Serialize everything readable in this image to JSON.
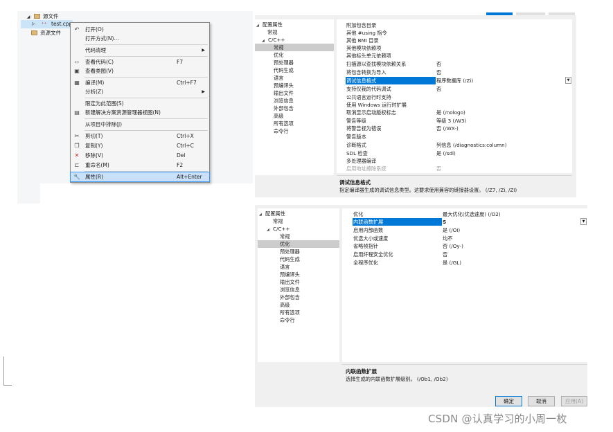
{
  "solution_explorer": {
    "source_folder": "源文件",
    "file_name": "test.cpp",
    "resource_folder": "资源文件"
  },
  "context_menu": {
    "items": [
      {
        "label": "打开(O)",
        "shortcut": "",
        "icon": "open-icon"
      },
      {
        "label": "打开方式(N)...",
        "shortcut": "",
        "icon": ""
      },
      {
        "label": "代码清理",
        "shortcut": "",
        "icon": ""
      },
      {
        "label": "查看代码(C)",
        "shortcut": "F7",
        "icon": "code-icon"
      },
      {
        "label": "查看类图(V)",
        "shortcut": "",
        "icon": "class-diagram-icon"
      },
      {
        "label": "编译(M)",
        "shortcut": "Ctrl+F7",
        "icon": "compile-icon"
      },
      {
        "label": "分析(Z)",
        "shortcut": "",
        "icon": ""
      },
      {
        "label": "限定为此范围(S)",
        "shortcut": "",
        "icon": ""
      },
      {
        "label": "新建解决方案资源管理器视图(N)",
        "shortcut": "",
        "icon": "new-view-icon"
      },
      {
        "label": "从项目中排除(J)",
        "shortcut": "",
        "icon": ""
      },
      {
        "label": "剪切(T)",
        "shortcut": "Ctrl+X",
        "icon": "cut-icon"
      },
      {
        "label": "复制(Y)",
        "shortcut": "Ctrl+C",
        "icon": "copy-icon"
      },
      {
        "label": "移除(V)",
        "shortcut": "Del",
        "icon": "remove-icon"
      },
      {
        "label": "重命名(M)",
        "shortcut": "F2",
        "icon": "rename-icon"
      },
      {
        "label": "属性(R)",
        "shortcut": "Alt+Enter",
        "icon": "wrench-icon"
      }
    ]
  },
  "dialog1": {
    "tree": [
      {
        "label": "配置属性",
        "expanded": true
      },
      {
        "label": "常规"
      },
      {
        "label": "C/C++",
        "expanded": true
      },
      {
        "label": "常规",
        "selected": true
      },
      {
        "label": "优化"
      },
      {
        "label": "预处理器"
      },
      {
        "label": "代码生成"
      },
      {
        "label": "语言"
      },
      {
        "label": "预编译头"
      },
      {
        "label": "输出文件"
      },
      {
        "label": "浏览信息"
      },
      {
        "label": "外部包含"
      },
      {
        "label": "高级"
      },
      {
        "label": "所有选项"
      },
      {
        "label": "命令行"
      }
    ],
    "rows": [
      {
        "name": "附加包含目录",
        "value": ""
      },
      {
        "name": "其他 #using 指令",
        "value": ""
      },
      {
        "name": "其他 BMI 目录",
        "value": ""
      },
      {
        "name": "其他模块依赖项",
        "value": ""
      },
      {
        "name": "其他标头单元依赖项",
        "value": ""
      },
      {
        "name": "扫描源以查找模块依赖关系",
        "value": "否"
      },
      {
        "name": "将包含转换为导入",
        "value": "否"
      },
      {
        "name": "调试信息格式",
        "value": "程序数据库 (/Zi)",
        "selected": true
      },
      {
        "name": "支持仅我的代码调试",
        "value": "否"
      },
      {
        "name": "公共语言运行时支持",
        "value": ""
      },
      {
        "name": "使用 Windows 运行时扩展",
        "value": ""
      },
      {
        "name": "取消显示启动版权标志",
        "value": "是 (/nologo)"
      },
      {
        "name": "警告等级",
        "value": "等级 3 (/W3)"
      },
      {
        "name": "将警告视为错误",
        "value": "否 (/WX-)"
      },
      {
        "name": "警告版本",
        "value": ""
      },
      {
        "name": "诊断格式",
        "value": "列信息 (/diagnostics:column)"
      },
      {
        "name": "SDL 检查",
        "value": "是 (/sdl)"
      },
      {
        "name": "多处理器编译",
        "value": ""
      },
      {
        "name": "启用地址擦除系统",
        "value": "否",
        "dim": true
      }
    ],
    "description": {
      "title": "调试信息格式",
      "text": "指定编译器生成的调试信息类型。这要求使用兼容的链接器设置。  (/Z7, /Zi, /ZI)"
    }
  },
  "dialog2": {
    "tree": [
      {
        "label": "配置属性",
        "expanded": true
      },
      {
        "label": "常规"
      },
      {
        "label": "C/C++",
        "expanded": true
      },
      {
        "label": "常规"
      },
      {
        "label": "优化",
        "selected": true
      },
      {
        "label": "预处理器"
      },
      {
        "label": "代码生成"
      },
      {
        "label": "语言"
      },
      {
        "label": "预编译头"
      },
      {
        "label": "输出文件"
      },
      {
        "label": "浏览信息"
      },
      {
        "label": "外部包含"
      },
      {
        "label": "高级"
      },
      {
        "label": "所有选项"
      },
      {
        "label": "命令行"
      }
    ],
    "rows": [
      {
        "name": "优化",
        "value": "最大优化(优选速度) (/O2)"
      },
      {
        "name": "内联函数扩展",
        "value": "S",
        "selected": true
      },
      {
        "name": "启用内部函数",
        "value": "是 (/Oi)"
      },
      {
        "name": "优选大小或速度",
        "value": "均不"
      },
      {
        "name": "省略帧指针",
        "value": "否 (/Oy-)"
      },
      {
        "name": "启用纤程安全优化",
        "value": "否"
      },
      {
        "name": "全程序优化",
        "value": "是 (/GL)"
      }
    ],
    "description": {
      "title": "内联函数扩展",
      "text": "选择生成的内联函数扩展级别。    (/Ob1, /Ob2)"
    },
    "buttons": {
      "ok": "确定",
      "cancel": "取消",
      "apply": "应用(A)"
    }
  },
  "watermark": "CSDN @认真学习的小周一枚",
  "colors": {
    "selection_blue": "#0078d7",
    "menu_highlight": "#c9e0f7",
    "tree_selected": "#cccccc"
  }
}
